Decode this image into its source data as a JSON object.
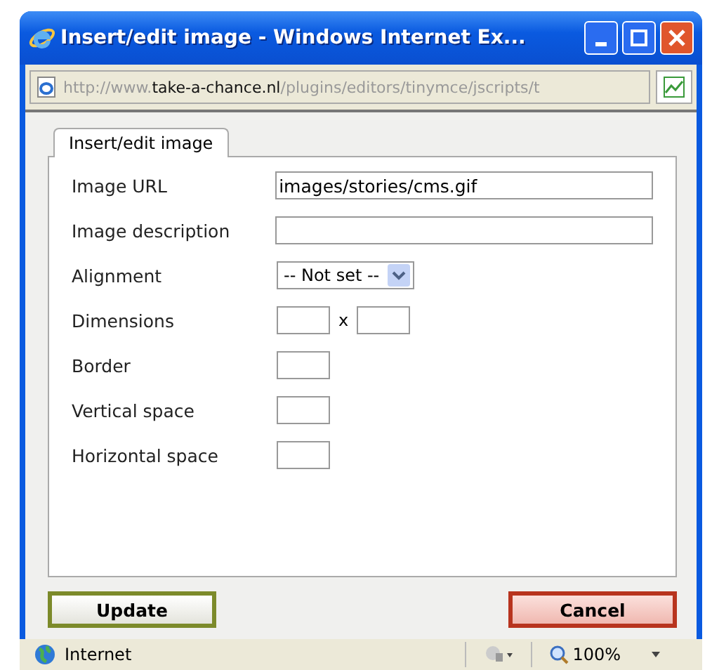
{
  "window": {
    "title": "Insert/edit image - Windows Internet Ex..."
  },
  "address_bar": {
    "url": "http://www.**take-a-chance.nl**/plugins/editors/tinymce/jscripts/t"
  },
  "tabs": [
    {
      "label": "Insert/edit image",
      "selected": true
    }
  ],
  "fields": [
    {
      "kind": "text",
      "label": "Image URL",
      "value": "images/stories/cms.gif"
    },
    {
      "kind": "text",
      "label": "Image description"
    },
    {
      "kind": "select",
      "label": "Alignment",
      "value": "-- Not set --"
    },
    {
      "kind": "dimensions",
      "label": "Dimensions",
      "separator": "x"
    },
    {
      "kind": "small",
      "label": "Border"
    },
    {
      "kind": "small",
      "label": "Vertical space"
    },
    {
      "kind": "small",
      "label": "Horizontal space"
    }
  ],
  "buttons": [
    {
      "label": "Update",
      "kind": "primary"
    },
    {
      "label": "Cancel",
      "kind": "cancel"
    }
  ],
  "status_bar": {
    "zone": "Internet",
    "zoom": "100%"
  }
}
